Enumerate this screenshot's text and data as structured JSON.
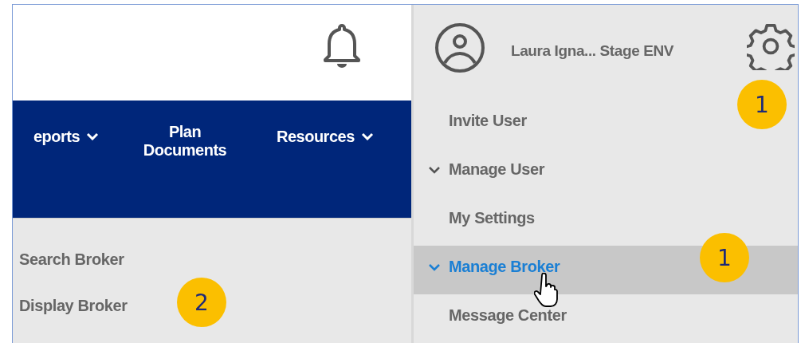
{
  "nav": {
    "items": [
      {
        "label": "eports",
        "dropdown": true
      },
      {
        "label": "Plan Documents",
        "dropdown": false
      },
      {
        "label": "Resources",
        "dropdown": true
      }
    ]
  },
  "submenu": {
    "items": [
      {
        "label": "Search Broker"
      },
      {
        "label": "Display Broker"
      }
    ]
  },
  "user_menu": {
    "user_name": "Laura Igna... Stage ENV",
    "items": [
      {
        "label": "Invite User",
        "has_submenu": false,
        "selected": false
      },
      {
        "label": "Manage User",
        "has_submenu": true,
        "selected": false
      },
      {
        "label": "My Settings",
        "has_submenu": false,
        "selected": false
      },
      {
        "label": "Manage Broker",
        "has_submenu": true,
        "selected": true
      },
      {
        "label": "Message Center",
        "has_submenu": false,
        "selected": false
      }
    ]
  },
  "callouts": [
    {
      "label": "1"
    },
    {
      "label": "1"
    },
    {
      "label": "2"
    }
  ]
}
